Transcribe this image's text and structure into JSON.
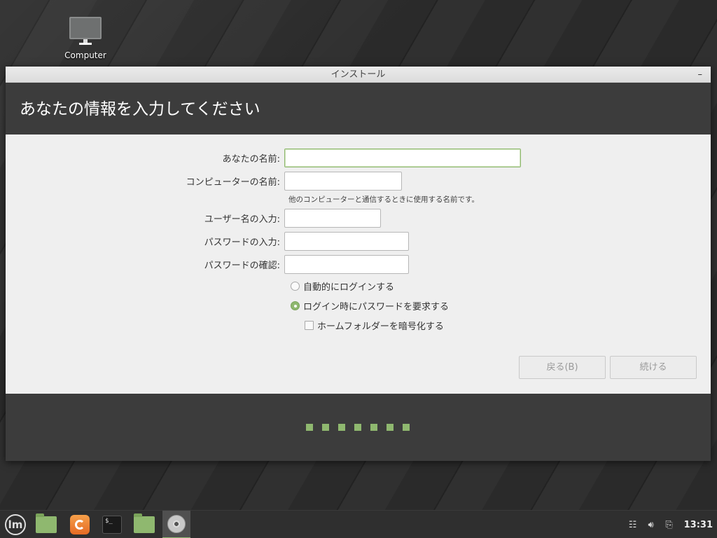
{
  "desktop": {
    "icons": [
      {
        "label": "Computer",
        "icon": "monitor-icon"
      }
    ]
  },
  "window": {
    "title": "インストール",
    "minimize_glyph": "–",
    "header": "あなたの情報を入力してください",
    "form": {
      "your_name_label": "あなたの名前:",
      "your_name_value": "",
      "computer_name_label": "コンピューターの名前:",
      "computer_name_value": "",
      "computer_name_hint": "他のコンピューターと通信するときに使用する名前です。",
      "username_label": "ユーザー名の入力:",
      "username_value": "",
      "password_label": "パスワードの入力:",
      "password_value": "",
      "password_confirm_label": "パスワードの確認:",
      "password_confirm_value": "",
      "auto_login_label": "自動的にログインする",
      "auto_login_selected": false,
      "require_password_label": "ログイン時にパスワードを要求する",
      "require_password_selected": true,
      "encrypt_home_label": "ホームフォルダーを暗号化する",
      "encrypt_home_checked": false
    },
    "buttons": {
      "back_label": "戻る(B)",
      "continue_label": "続ける"
    },
    "progress": {
      "total_steps": 7,
      "color": "#8fb86f"
    }
  },
  "taskbar": {
    "apps": [
      "mint-menu-icon",
      "show-desktop-icon",
      "firefox-icon",
      "terminal-icon",
      "files-icon",
      "installer-disc-icon"
    ],
    "terminal_glyph": "$_",
    "clock": "13:31",
    "tray": [
      "network-icon",
      "volume-icon",
      "clipboard-icon"
    ]
  },
  "colors": {
    "accent": "#8fb86f",
    "header_band": "#3c3c3c",
    "form_bg": "#efefef"
  }
}
